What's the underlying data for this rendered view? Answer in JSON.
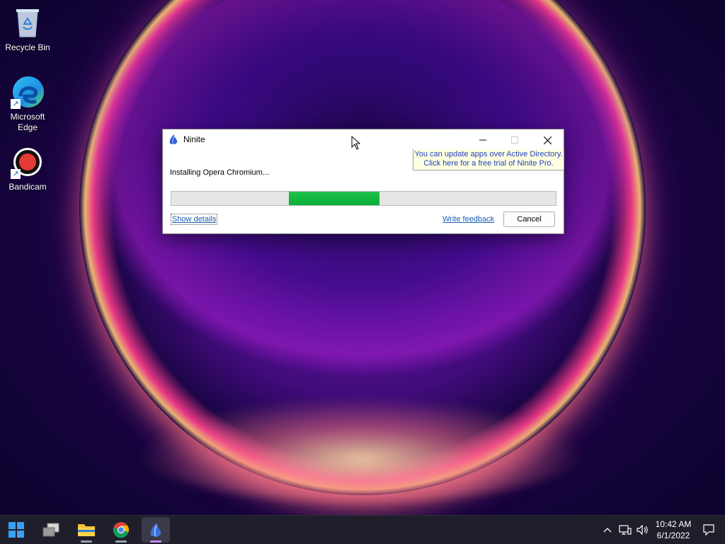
{
  "desktop": {
    "icons": [
      {
        "label": "Recycle Bin"
      },
      {
        "label": "Microsoft Edge"
      },
      {
        "label": "Bandicam"
      }
    ]
  },
  "window": {
    "title": "Ninite",
    "ad_note_line1": "You can update apps over Active Directory.",
    "ad_note_line2": "Click here for a free trial of Ninite Pro.",
    "status": "Installing Opera Chromium...",
    "progress": {
      "fill_start": 0.305,
      "fill_end": 0.54,
      "color": "#0fb845"
    },
    "show_details_label": "Show details",
    "write_feedback_label": "Write feedback",
    "cancel_label": "Cancel"
  },
  "taskbar": {
    "apps": [
      {
        "name": "start",
        "icon": "windows-logo-icon"
      },
      {
        "name": "task-view",
        "icon": "task-view-icon"
      },
      {
        "name": "file-explorer",
        "icon": "folder-icon"
      },
      {
        "name": "chrome",
        "icon": "chrome-icon"
      },
      {
        "name": "ninite",
        "icon": "ninite-icon",
        "active": true
      }
    ],
    "clock": {
      "time": "10:42 AM",
      "date": "6/1/2022"
    }
  },
  "colors": {
    "link": "#1a5fb4",
    "note_bg": "#ffffe1",
    "taskbar_bg": "#1f1f2b",
    "progress_green": "#0fb845"
  }
}
